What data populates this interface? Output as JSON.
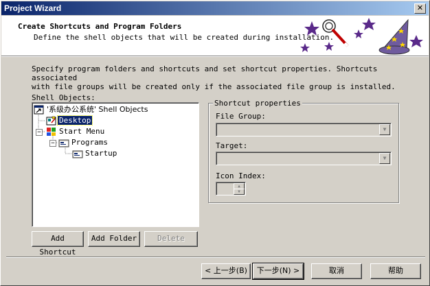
{
  "window": {
    "title": "Project Wizard",
    "close_glyph": "✕"
  },
  "header": {
    "heading": "Create Shortcuts and Program Folders",
    "subheading": "Define the shell objects that will be created during installation."
  },
  "description": {
    "line1": "Specify program folders and shortcuts and set shortcut properties.  Shortcuts associated",
    "line2": "with file groups will be created only if the associated file group is installed."
  },
  "shell_objects": {
    "label": "Shell Objects:",
    "tree": [
      {
        "label": "'系级办公系统' Shell Objects",
        "icon": "shortcut-root-icon"
      },
      {
        "label": "Desktop",
        "icon": "desktop-icon",
        "selected": true
      },
      {
        "label": "Start Menu",
        "icon": "start-menu-icon"
      },
      {
        "label": "Programs",
        "icon": "programs-folder-icon"
      },
      {
        "label": "Startup",
        "icon": "startup-folder-icon"
      }
    ]
  },
  "buttons": {
    "add_shortcut": "Add Shortcut",
    "add_folder": "Add Folder",
    "delete": "Delete"
  },
  "shortcut_properties": {
    "legend": "Shortcut properties",
    "file_group_label": "File Group:",
    "target_label": "Target:",
    "icon_index_label": "Icon Index:"
  },
  "footer": {
    "back": "< 上一步(B)",
    "next": "下一步(N) >",
    "cancel": "取消",
    "help": "帮助"
  },
  "colors": {
    "title_start": "#0a246a",
    "title_end": "#a6caf0",
    "selection": "#0a246a",
    "face": "#d4d0c8"
  }
}
